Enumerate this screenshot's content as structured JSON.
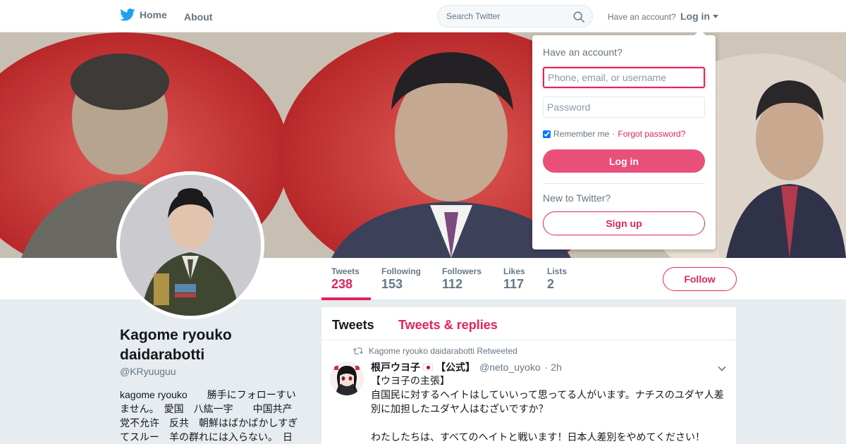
{
  "nav": {
    "home_label": "Home",
    "about_label": "About",
    "search_placeholder": "Search Twitter",
    "have_account": "Have an account?",
    "login_label": "Log in"
  },
  "profile": {
    "name": "Kagome ryouko daidarabotti",
    "handle": "@KRyuuguu",
    "bio": "kagome ryouko　　勝手にフォローすいません。　愛国　八紘一宇　　中国共产党不允许　反共　朝鮮はばかばかしすぎてスルー　羊の群れには入らない。　日"
  },
  "stats": [
    {
      "label": "Tweets",
      "value": "238"
    },
    {
      "label": "Following",
      "value": "153"
    },
    {
      "label": "Followers",
      "value": "112"
    },
    {
      "label": "Likes",
      "value": "117"
    },
    {
      "label": "Lists",
      "value": "2"
    }
  ],
  "follow_label": "Follow",
  "timeline": {
    "tabs": [
      "Tweets",
      "Tweets & replies"
    ],
    "tweet": {
      "retweet_text": "Kagome ryouko daidarabotti Retweeted",
      "name": "根戸ウヨ子",
      "name_suffix": "【公式】",
      "handle": "@neto_uyoko",
      "time": "· 2h",
      "text": "【ウヨ子の主張】\n自国民に対するヘイトはしていいって思ってる人がいます。ナチスのユダヤ人差別に加担したユダヤ人はむざいですか？\n\nわたしたちは、すべてのヘイトと戦います！日本人差別をやめてください！"
    }
  },
  "login_dropdown": {
    "title": "Have an account?",
    "username_placeholder": "Phone, email, or username",
    "password_placeholder": "Password",
    "remember": "Remember me",
    "separator": "·",
    "forgot": "Forgot password?",
    "login_button": "Log in",
    "new_text": "New to Twitter?",
    "signup_button": "Sign up"
  },
  "colors": {
    "accent": "#e0245e",
    "twitter_blue": "#1da1f2",
    "text_secondary": "#657786",
    "background": "#e6ecf0"
  },
  "icons": [
    "twitter-bird-icon",
    "search-icon",
    "caret-down-icon",
    "retweet-icon",
    "chevron-down-icon",
    "japan-flag-icon"
  ]
}
